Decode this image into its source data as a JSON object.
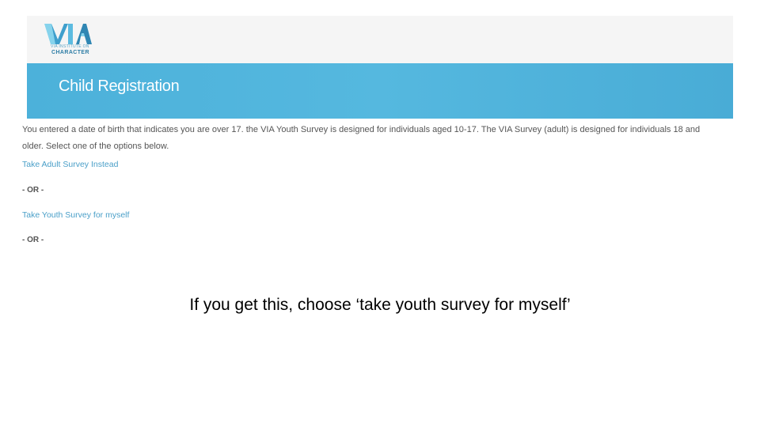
{
  "logo": {
    "name": "VIA",
    "tagline": "VIA INSTITUTE ON",
    "subname": "CHARACTER",
    "colors": {
      "light": "#7fd0ea",
      "dark": "#2f86b3"
    }
  },
  "banner": {
    "title": "Child Registration",
    "color": "#4cb1da"
  },
  "content": {
    "message": "You entered a date of birth that indicates you are over 17. the VIA Youth Survey is designed for individuals aged 10-17. The VIA Survey (adult) is designed for individuals 18 and older. Select one of the options below.",
    "option_adult": "Take Adult Survey Instead",
    "separator_1": "- OR -",
    "option_youth": "Take Youth Survey for myself",
    "separator_2": "- OR -",
    "link_color": "#4a9fc8"
  },
  "caption": "If you get this, choose ‘take youth survey for myself’"
}
